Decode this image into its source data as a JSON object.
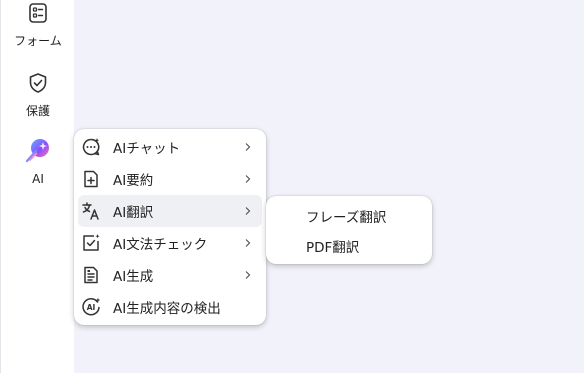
{
  "sidebar": {
    "items": [
      {
        "label": "フォーム",
        "icon": "form-icon"
      },
      {
        "label": "保護",
        "icon": "shield-icon"
      },
      {
        "label": "AI",
        "icon": "ai-icon"
      }
    ]
  },
  "ai_menu": {
    "items": [
      {
        "label": "AIチャット",
        "icon": "chat-icon",
        "has_submenu": true
      },
      {
        "label": "AI要約",
        "icon": "summary-icon",
        "has_submenu": true
      },
      {
        "label": "AI翻訳",
        "icon": "translate-icon",
        "has_submenu": true,
        "active": true
      },
      {
        "label": "AI文法チェック",
        "icon": "grammar-check-icon",
        "has_submenu": true
      },
      {
        "label": "AI生成",
        "icon": "generate-icon",
        "has_submenu": true
      },
      {
        "label": "AI生成内容の検出",
        "icon": "ai-detect-icon",
        "has_submenu": false
      }
    ]
  },
  "translate_submenu": {
    "items": [
      {
        "label": "フレーズ翻訳"
      },
      {
        "label": "PDF翻訳"
      }
    ]
  },
  "colors": {
    "background": "#f2f3fa",
    "icon_stroke": "#333333",
    "ai_icon_gradient": [
      "#4fa3ff",
      "#8a4dff",
      "#ff6fb5"
    ]
  }
}
